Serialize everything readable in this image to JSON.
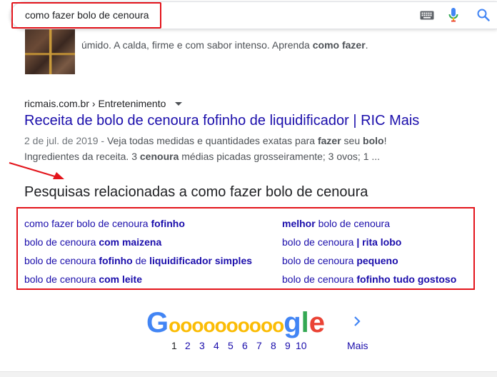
{
  "search": {
    "query": "como fazer bolo de cenoura"
  },
  "icons": {
    "keyboard": "keyboard-icon",
    "mic": "mic-icon",
    "search": "search-icon"
  },
  "colors": {
    "link": "#1a0dab",
    "annotation": "#e3141b",
    "google_blue": "#4285f4",
    "google_red": "#ea4335",
    "google_yellow": "#fbbc05",
    "google_green": "#34a853"
  },
  "result1": {
    "snippet": "úmido. A calda, firme e com sabor intenso. Aprenda ",
    "snippet_bold": "como fazer",
    "snippet_end": "."
  },
  "result2": {
    "cite": "ricmais.com.br › Entretenimento",
    "title": "Receita de bolo de cenoura fofinho de liquidificador | RIC Mais",
    "date": "2 de jul. de 2019 - ",
    "line1_a": "Veja todas medidas e quantidades exatas para ",
    "line1_b1": "fazer",
    "line1_c": " seu ",
    "line1_b2": "bolo",
    "line1_d": "!",
    "line2_a": "Ingredientes da receita. 3 ",
    "line2_b": "cenoura",
    "line2_c": " médias picadas grosseiramente; 3 ovos; 1 ..."
  },
  "related": {
    "heading": "Pesquisas relacionadas a como fazer bolo de cenoura",
    "items": [
      {
        "plain": "como fazer bolo de cenoura ",
        "bold": "fofinho",
        "tail_plain": "",
        "tail_bold": ""
      },
      {
        "plain": "bolo de cenoura ",
        "bold": "com maizena",
        "tail_plain": "",
        "tail_bold": ""
      },
      {
        "plain": "bolo de cenoura ",
        "bold": "fofinho",
        "tail_plain": " de ",
        "tail_bold": "liquidificador simples"
      },
      {
        "plain": "bolo de cenoura ",
        "bold": "com leite",
        "tail_plain": "",
        "tail_bold": ""
      },
      {
        "bold_first": "melhor",
        "plain": " bolo de cenoura"
      },
      {
        "plain": "bolo de cenoura ",
        "bold": "| rita lobo"
      },
      {
        "plain": "bolo de cenoura ",
        "bold": "pequeno"
      },
      {
        "plain": "bolo de cenoura ",
        "bold": "fofinho tudo gostoso"
      }
    ]
  },
  "pagination": {
    "logo_G": "G",
    "logo_o": "o",
    "logo_g": "g",
    "logo_l": "l",
    "logo_e": "e",
    "pages": [
      "1",
      "2",
      "3",
      "4",
      "5",
      "6",
      "7",
      "8",
      "9",
      "10"
    ],
    "current_page": "1",
    "next_label": "Mais"
  }
}
